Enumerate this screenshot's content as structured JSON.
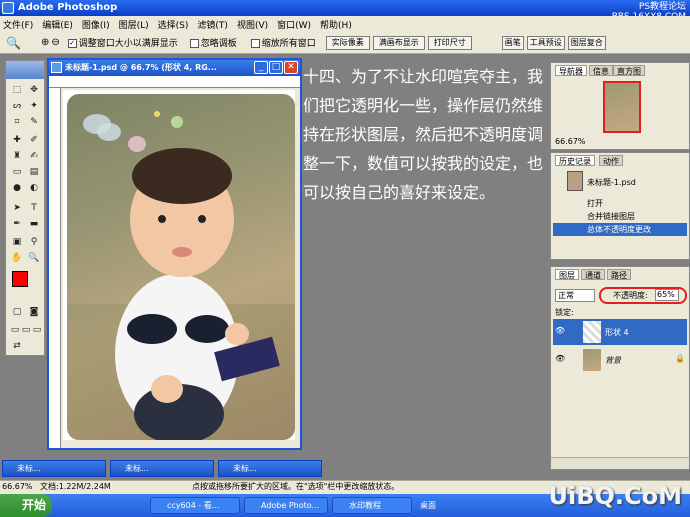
{
  "app_title": "Adobe Photoshop",
  "watermark_top": {
    "line1": "PS教程论坛",
    "line2": "BBS.16XX8.COM"
  },
  "menu": [
    "文件(F)",
    "编辑(E)",
    "图像(I)",
    "图层(L)",
    "选择(S)",
    "滤镜(T)",
    "视图(V)",
    "窗口(W)",
    "帮助(H)"
  ],
  "options": {
    "resize_windows": "调整窗口大小以满屏显示",
    "ignore_palettes": "忽略调板",
    "zoom_all": "缩放所有窗口",
    "actual_pixels": "实际像素",
    "fit_screen": "满画布显示",
    "print_size": "打印尺寸"
  },
  "palette_well": [
    "画笔",
    "工具预设",
    "图层复合"
  ],
  "document": {
    "title": "未标题-1.psd @ 66.7% (形状 4, RG..."
  },
  "instruction": "十四、为了不让水印喧宾夺主，我们把它透明化一些，操作层仍然维持在形状图层，然后把不透明度调整一下，数值可以按我的设定，也可以按自己的喜好来设定。",
  "navigator": {
    "tabs": [
      "导航器",
      "信息",
      "直方图"
    ],
    "zoom": "66.67%"
  },
  "history": {
    "tabs": [
      "历史记录",
      "动作"
    ],
    "snapshot": "未标题-1.psd",
    "items": [
      "打开",
      "合并链接图层",
      "总体不透明度更改"
    ]
  },
  "layers": {
    "tabs": [
      "图层",
      "通道",
      "路径"
    ],
    "blend_mode": "正常",
    "opacity_label": "不透明度:",
    "opacity_value": "65%",
    "lock_label": "锁定:",
    "items": [
      "形状 4",
      "背景"
    ]
  },
  "minimized_docs": [
    "未标...",
    "未标...",
    "未标..."
  ],
  "status": {
    "zoom": "66.67%",
    "doc_size": "文档:1.22M/2.24M",
    "hint": "点按或拖移所要扩大的区域。在\"选项\"栏中更改缩放状态。"
  },
  "taskbar": {
    "start": "开始",
    "tasks": [
      "ccy604 - 看...",
      "Adobe Photo...",
      "水印教程"
    ],
    "tray": "桌面"
  },
  "site_watermark": "UiBQ.CoM",
  "colors": {
    "accent": "#2156d6",
    "foreground": "#ff0000",
    "background": "#000000"
  }
}
